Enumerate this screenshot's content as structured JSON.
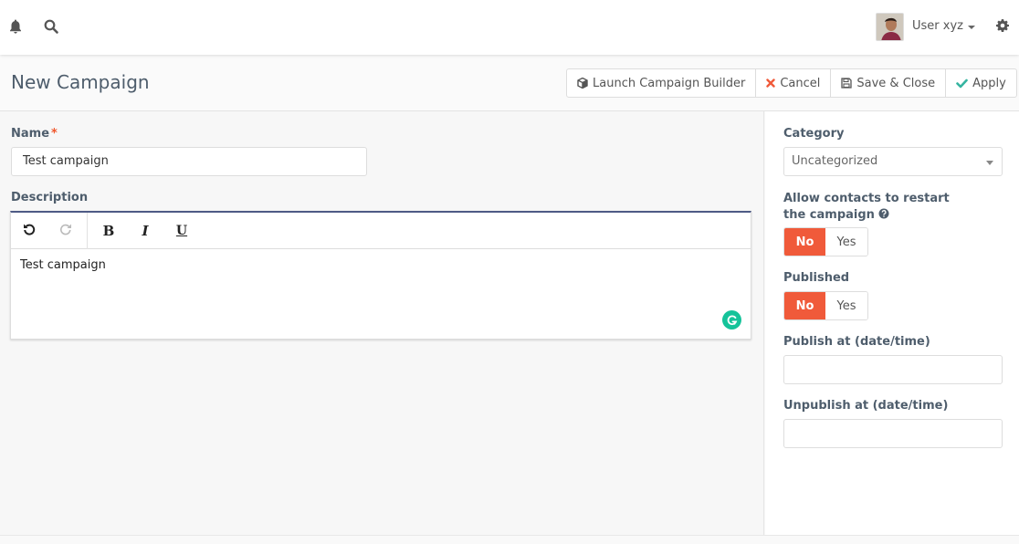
{
  "topbar": {
    "notifications_icon": "bell-icon",
    "search_icon": "search-icon",
    "user_name": "User xyz",
    "settings_icon": "gear-icon"
  },
  "header": {
    "title": "New Campaign",
    "buttons": [
      {
        "label": "Launch Campaign Builder",
        "icon": "cube-icon"
      },
      {
        "label": "Cancel",
        "icon": "close-icon",
        "color": "#f05a3a"
      },
      {
        "label": "Save & Close",
        "icon": "save-icon"
      },
      {
        "label": "Apply",
        "icon": "check-icon",
        "color": "#35b4a0"
      }
    ]
  },
  "form": {
    "name_label": "Name",
    "required_mark": "*",
    "name_value": "Test campaign",
    "description_label": "Description",
    "editor": {
      "toolbar": {
        "undo_icon": "undo-icon",
        "redo_icon": "redo-icon",
        "bold": "B",
        "italic": "I",
        "underline": "U"
      },
      "content": "Test campaign"
    }
  },
  "sidebar": {
    "category_label": "Category",
    "category_value": "Uncategorized",
    "restart_label": "Allow contacts to restart the campaign",
    "restart_options": {
      "no": "No",
      "yes": "Yes",
      "selected": "No"
    },
    "published_label": "Published",
    "published_options": {
      "no": "No",
      "yes": "Yes",
      "selected": "No"
    },
    "publish_at_label": "Publish at (date/time)",
    "publish_at_value": "",
    "unpublish_at_label": "Unpublish at (date/time)",
    "unpublish_at_value": ""
  },
  "colors": {
    "accent": "#f05a3a",
    "editor_border": "#4e5b85",
    "grammarly": "#15c39a",
    "apply_check": "#35b4a0"
  }
}
